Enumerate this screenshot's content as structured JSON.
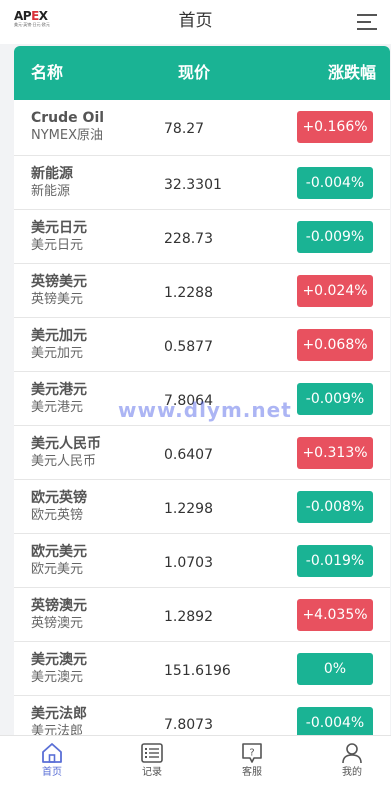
{
  "header": {
    "logo_text_a": "AP",
    "logo_text_b": "E",
    "logo_text_c": "X",
    "logo_sub": "美元·英镑·日元·欧元",
    "title": "首页"
  },
  "table": {
    "col_name": "名称",
    "col_price": "现价",
    "col_change": "涨跌幅",
    "rows": [
      {
        "name": "Crude Oil",
        "sub": "NYMEX原油",
        "price": "78.27",
        "change": "+0.166%",
        "dir": "up"
      },
      {
        "name": "新能源",
        "sub": "新能源",
        "price": "32.3301",
        "change": "-0.004%",
        "dir": "down"
      },
      {
        "name": "美元日元",
        "sub": "美元日元",
        "price": "228.73",
        "change": "-0.009%",
        "dir": "down"
      },
      {
        "name": "英镑美元",
        "sub": "英镑美元",
        "price": "1.2288",
        "change": "+0.024%",
        "dir": "up"
      },
      {
        "name": "美元加元",
        "sub": "美元加元",
        "price": "0.5877",
        "change": "+0.068%",
        "dir": "up"
      },
      {
        "name": "美元港元",
        "sub": "美元港元",
        "price": "7.8064",
        "change": "-0.009%",
        "dir": "down"
      },
      {
        "name": "美元人民币",
        "sub": "美元人民币",
        "price": "0.6407",
        "change": "+0.313%",
        "dir": "up"
      },
      {
        "name": "欧元英镑",
        "sub": "欧元英镑",
        "price": "1.2298",
        "change": "-0.008%",
        "dir": "down"
      },
      {
        "name": "欧元美元",
        "sub": "欧元美元",
        "price": "1.0703",
        "change": "-0.019%",
        "dir": "down"
      },
      {
        "name": "英镑澳元",
        "sub": "英镑澳元",
        "price": "1.2892",
        "change": "+4.035%",
        "dir": "up"
      },
      {
        "name": "美元澳元",
        "sub": "美元澳元",
        "price": "151.6196",
        "change": "0%",
        "dir": "down"
      },
      {
        "name": "美元法郎",
        "sub": "美元法郎",
        "price": "7.8073",
        "change": "-0.004%",
        "dir": "down"
      }
    ]
  },
  "watermark": "www.dlym.net",
  "tabbar": {
    "items": [
      {
        "label": "首页",
        "icon": "home-icon",
        "active": true
      },
      {
        "label": "记录",
        "icon": "list-icon",
        "active": false
      },
      {
        "label": "客服",
        "icon": "help-chat-icon",
        "active": false
      },
      {
        "label": "我的",
        "icon": "user-icon",
        "active": false
      }
    ]
  },
  "colors": {
    "accent": "#1ab394",
    "up": "#e8515f",
    "down": "#1ab394",
    "tab_active": "#5a6fd6"
  }
}
